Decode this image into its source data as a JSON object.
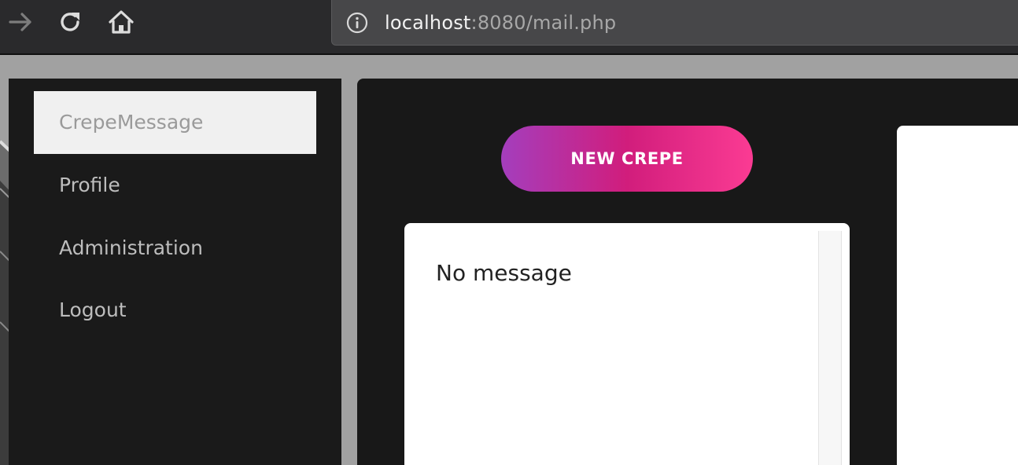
{
  "browser": {
    "back_icon": "arrow-right-icon",
    "reload_icon": "reload-icon",
    "home_icon": "home-icon",
    "info_icon": "info-icon",
    "url_host": "localhost",
    "url_rest": ":8080/mail.php"
  },
  "sidebar": {
    "items": [
      {
        "label": "CrepeMessage",
        "active": true
      },
      {
        "label": "Profile"
      },
      {
        "label": "Administration"
      },
      {
        "label": "Logout"
      }
    ]
  },
  "main": {
    "new_button_label": "NEW CREPE",
    "empty_message": "No message"
  },
  "colors": {
    "gradient_start": "#a43ebd",
    "gradient_mid": "#d11d7c",
    "gradient_end": "#fb3b93",
    "panel_bg": "#181818",
    "sidebar_bg": "#1a1a1a"
  }
}
